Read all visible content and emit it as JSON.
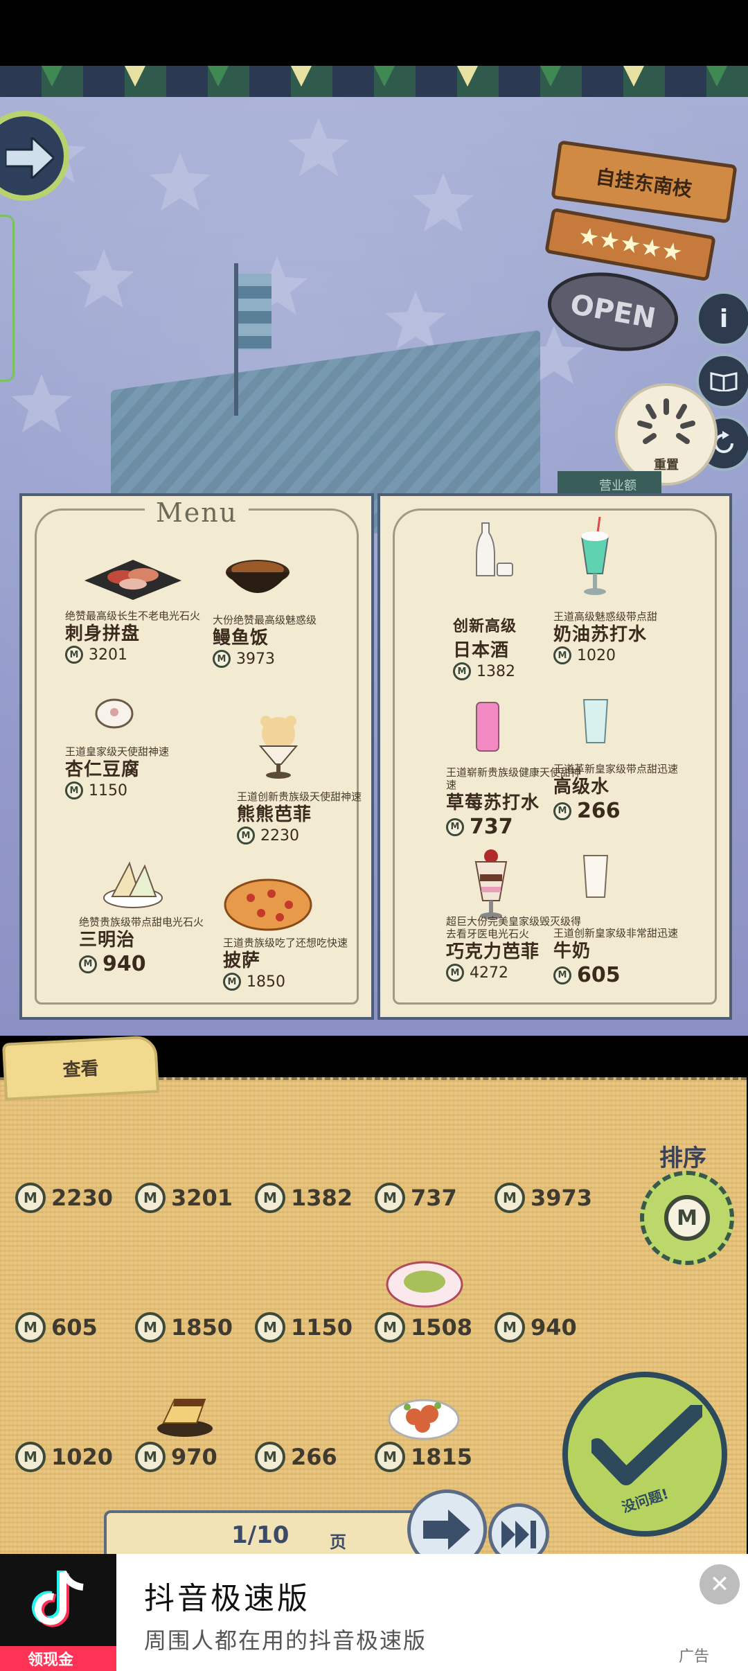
{
  "shop": {
    "name": "自挂东南枝",
    "stars": "★★★★★",
    "open_sign": "OPEN",
    "reset_label": "重置",
    "business_label": "营业额",
    "info_icon_glyph": "i"
  },
  "menu": {
    "title": "Menu",
    "left": [
      {
        "desc": "绝赞最高级长生不老电光石火",
        "name": "刺身拼盘",
        "price": "3201"
      },
      {
        "desc": "大份绝赞最高级魅惑级",
        "name": "鳗鱼饭",
        "price": "3973"
      },
      {
        "desc": "王道皇家级天使甜神速",
        "name": "杏仁豆腐",
        "price": "1150"
      },
      {
        "desc": "王道创新贵族级天使甜神速",
        "name": "熊熊芭菲",
        "price": "2230"
      },
      {
        "desc": "绝赞贵族级带点甜电光石火",
        "name": "三明治",
        "price": "940"
      },
      {
        "desc": "王道贵族级吃了还想吃快速",
        "name": "披萨",
        "price": "1850"
      }
    ],
    "right": [
      {
        "desc": "创新高级",
        "name": "日本酒",
        "price": "1382"
      },
      {
        "desc": "王道高级魅惑级带点甜",
        "name": "奶油苏打水",
        "price": "1020"
      },
      {
        "desc": "王道崭新贵族级健康天使甜神速",
        "name": "草莓苏打水",
        "price": "737"
      },
      {
        "desc": "王道革新皇家级带点甜迅速",
        "name": "高级水",
        "price": "266"
      },
      {
        "desc": "超巨大份完美皇家级毁灭级得去看牙医电光石火",
        "name": "巧克力芭菲",
        "price": "4272"
      },
      {
        "desc": "王道创新皇家级非常甜迅速",
        "name": "牛奶",
        "price": "605"
      }
    ]
  },
  "tray": {
    "tab_label": "查看",
    "sort_label": "排序",
    "confirm_label": "没问题!",
    "rows": [
      [
        "2230",
        "3201",
        "1382",
        "737",
        "3973"
      ],
      [
        "605",
        "1850",
        "1150",
        "1508",
        "940"
      ],
      [
        "1020",
        "970",
        "266",
        "1815"
      ]
    ],
    "page": "1/10",
    "page_unit": "页"
  },
  "ad": {
    "title": "抖音极速版",
    "subtitle": "周围人都在用的抖音极速版",
    "cash_label": "领现金",
    "ad_tag": "广告",
    "close_glyph": "✕"
  },
  "colors": {
    "paper": "#f3ead2",
    "tray": "#e9c680",
    "accent_green": "#b7d35f",
    "panel_border": "#4d5e76"
  }
}
